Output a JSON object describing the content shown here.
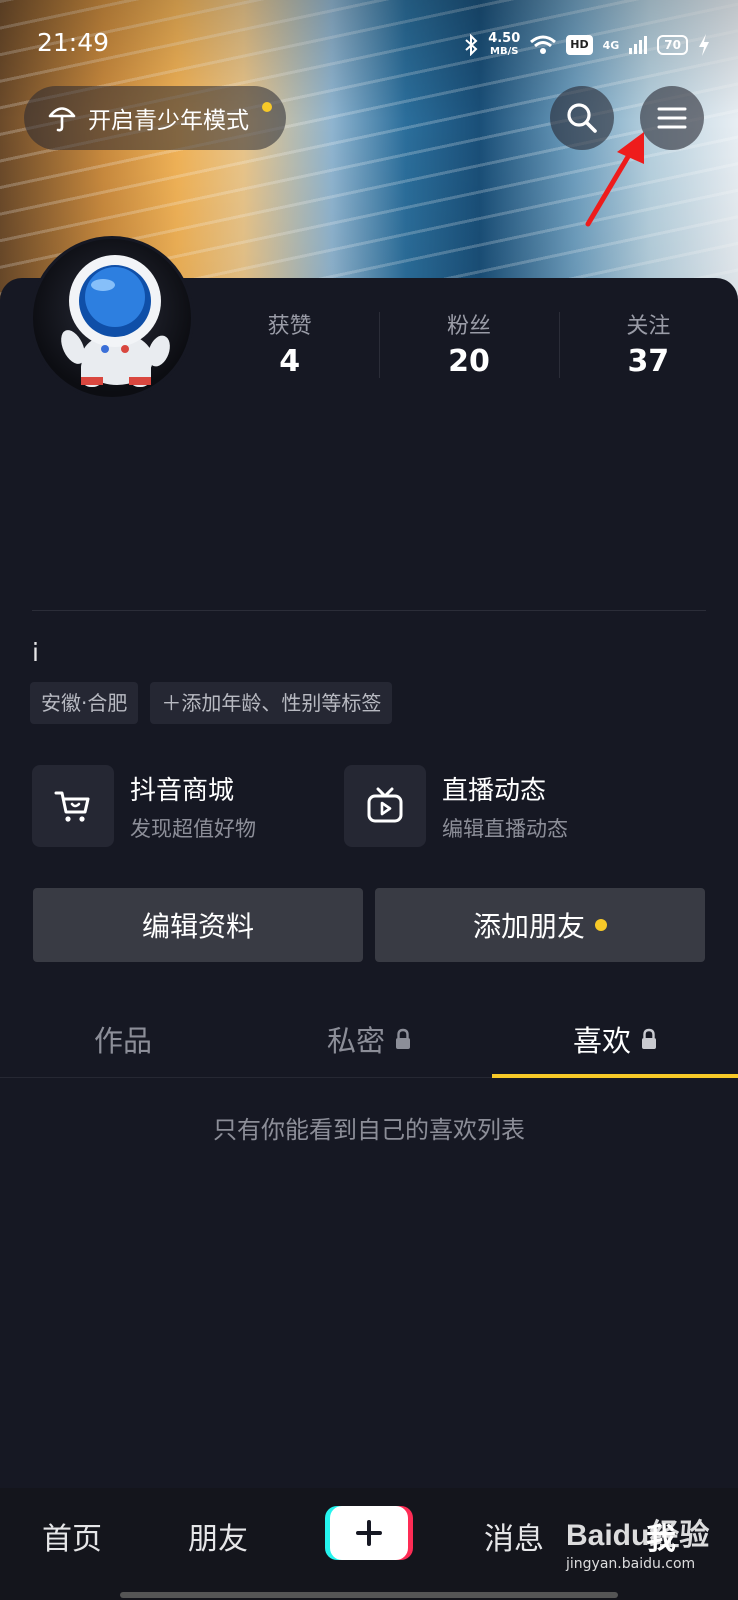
{
  "status_bar": {
    "time": "21:49",
    "net_speed_value": "4.50",
    "net_speed_unit": "MB/S",
    "hd_badge": "HD",
    "network_type": "4G",
    "battery": "70"
  },
  "header": {
    "teen_mode_label": "开启青少年模式"
  },
  "profile": {
    "stats": [
      {
        "label": "获赞",
        "value": "4"
      },
      {
        "label": "粉丝",
        "value": "20"
      },
      {
        "label": "关注",
        "value": "37"
      }
    ],
    "nickname": "i",
    "tags": [
      "安徽·合肥",
      "＋添加年龄、性别等标签"
    ]
  },
  "features": [
    {
      "title": "抖音商城",
      "subtitle": "发现超值好物",
      "icon": "cart-icon"
    },
    {
      "title": "直播动态",
      "subtitle": "编辑直播动态",
      "icon": "tv-icon"
    }
  ],
  "actions": {
    "edit_profile": "编辑资料",
    "add_friends": "添加朋友"
  },
  "tabs": [
    {
      "label": "作品",
      "locked": false,
      "active": false
    },
    {
      "label": "私密",
      "locked": true,
      "active": false
    },
    {
      "label": "喜欢",
      "locked": true,
      "active": true
    }
  ],
  "empty_hint": "只有你能看到自己的喜欢列表",
  "bottom_nav": {
    "home": "首页",
    "friends": "朋友",
    "messages": "消息",
    "me": "我"
  },
  "watermark": {
    "brand": "Baidu经验",
    "url": "jingyan.baidu.com"
  },
  "colors": {
    "background": "#161823",
    "accent_yellow": "#f7c928",
    "button_gray": "#393b44"
  }
}
